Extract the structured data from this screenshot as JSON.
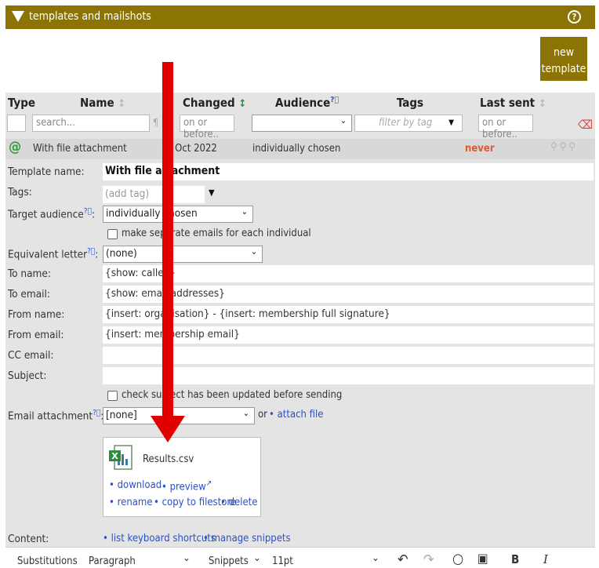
{
  "header": {
    "title": "templates and mailshots",
    "help": "?"
  },
  "new_template": "new\ntemplate",
  "columns": {
    "type": "Type",
    "name": "Name",
    "changed": "Changed",
    "audience": "Audience",
    "tags": "Tags",
    "last_sent": "Last sent"
  },
  "filters": {
    "name_placeholder": "search...",
    "changed_placeholder": "on or before..",
    "tags_placeholder": "filter by tag",
    "last_sent_placeholder": "on or before.."
  },
  "row": {
    "name": "With file attachment",
    "changed": "5 Oct 2022",
    "audience": "individually chosen",
    "last_sent": "never"
  },
  "form": {
    "template_name_label": "Template name:",
    "template_name_value": "With file attachment",
    "tags_label": "Tags:",
    "tags_placeholder": "(add tag)",
    "target_audience_label": "Target audience",
    "target_audience_value": "individually chosen",
    "separate_emails_label": "make separate emails for each individual",
    "equivalent_letter_label": "Equivalent letter",
    "equivalent_letter_value": "(none)",
    "to_name_label": "To name:",
    "to_name_value": "{show: called}",
    "to_email_label": "To email:",
    "to_email_value": "{show: email addresses}",
    "from_name_label": "From name:",
    "from_name_value": "{insert: organisation} - {insert: membership full signature}",
    "from_email_label": "From email:",
    "from_email_value": "{insert: membership email}",
    "cc_email_label": "CC email:",
    "subject_label": "Subject:",
    "check_subject_label": "check subject has been updated before sending",
    "email_attachment_label": "Email attachment",
    "email_attachment_value": "[none]",
    "or_text": "or",
    "attach_file": "• attach file"
  },
  "file": {
    "name": "Results.csv",
    "download": "• download",
    "preview": "• preview",
    "rename": "• rename",
    "copy": "• copy to filestore",
    "delete": "• delete"
  },
  "content": {
    "label": "Content:",
    "shortcuts": "• list keyboard shortcuts",
    "snippets": "• manage snippets"
  },
  "toolbar": {
    "substitutions": "Substitutions",
    "paragraph": "Paragraph",
    "snippets": "Snippets",
    "font_size": "11pt",
    "bold": "B",
    "italic": "I"
  },
  "colors": {
    "accent": "#8b7304",
    "never": "#e0592a",
    "arrow": "#e00000",
    "link": "#2a4fcf"
  }
}
